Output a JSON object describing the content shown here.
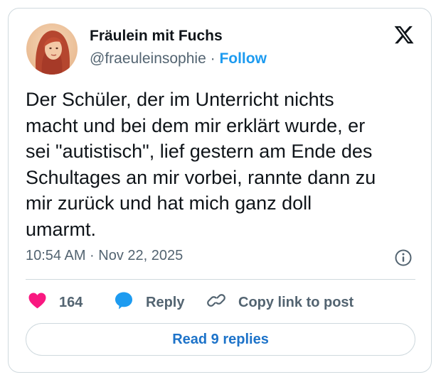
{
  "author": {
    "name": "Fräulein mit Fuchs",
    "handle": "@fraeuleinsophie",
    "separator": "·",
    "follow_label": "Follow"
  },
  "tweet": {
    "text": "Der Schüler, der im Unterricht nichts\nmacht und bei dem mir erklärt wurde, er\nsei \"autistisch\", lief gestern am Ende des\nSchultages an mir vorbei, rannte dann zu\nmir zurück und hat mich ganz doll\numarmt.",
    "timestamp": "10:54 AM · Nov 22, 2025"
  },
  "actions": {
    "like_count": "164",
    "reply_label": "Reply",
    "copy_label": "Copy link to post"
  },
  "read_replies_label": "Read 9 replies",
  "icons": {
    "brand": "x-logo-icon",
    "info": "info-icon",
    "like": "heart-icon",
    "reply": "speech-bubble-icon",
    "copy": "link-icon"
  },
  "colors": {
    "heart": "#f91880",
    "reply_bubble": "#1d9bf0",
    "follow": "#1d9bf0",
    "read_replies": "#1d73c9",
    "text": "#0f1419",
    "muted": "#536471",
    "border": "#cfd9de"
  }
}
